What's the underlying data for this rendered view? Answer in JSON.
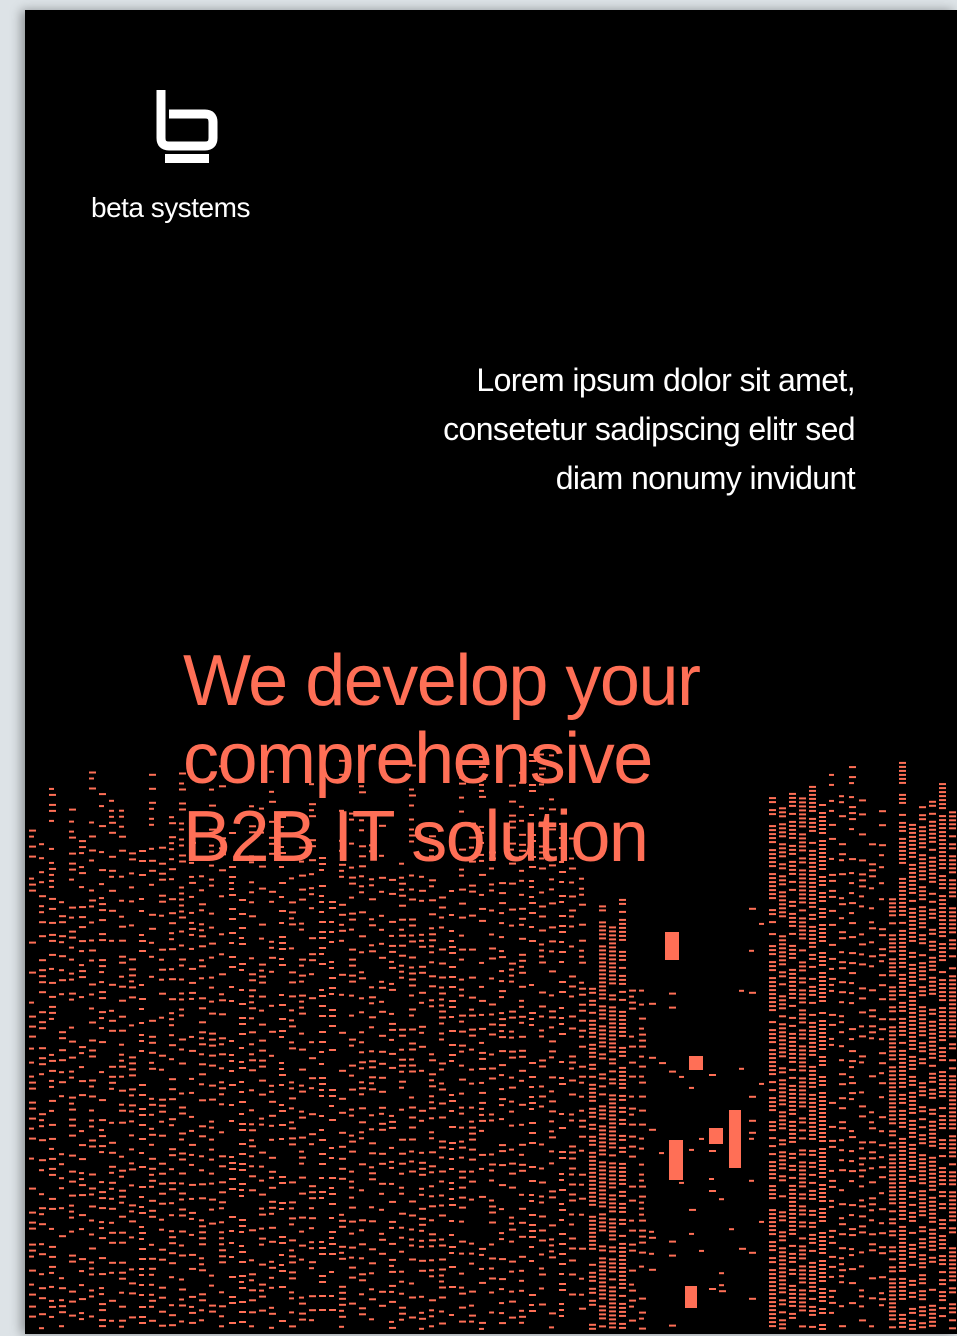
{
  "brand": {
    "name": "beta systems",
    "logo_icon": "beta-systems-b-logo",
    "logo_color": "#ffffff"
  },
  "subtitle": {
    "lines": [
      "Lorem ipsum dolor sit amet,",
      "consetetur sadipscing elitr sed",
      "diam nonumy invidunt"
    ]
  },
  "headline": {
    "lines": [
      "We develop your",
      "comprehensive",
      "B2B IT solution"
    ],
    "color": "#ff6f56"
  },
  "colors": {
    "background": "#000000",
    "accent": "#ff6f56",
    "text": "#ffffff"
  }
}
